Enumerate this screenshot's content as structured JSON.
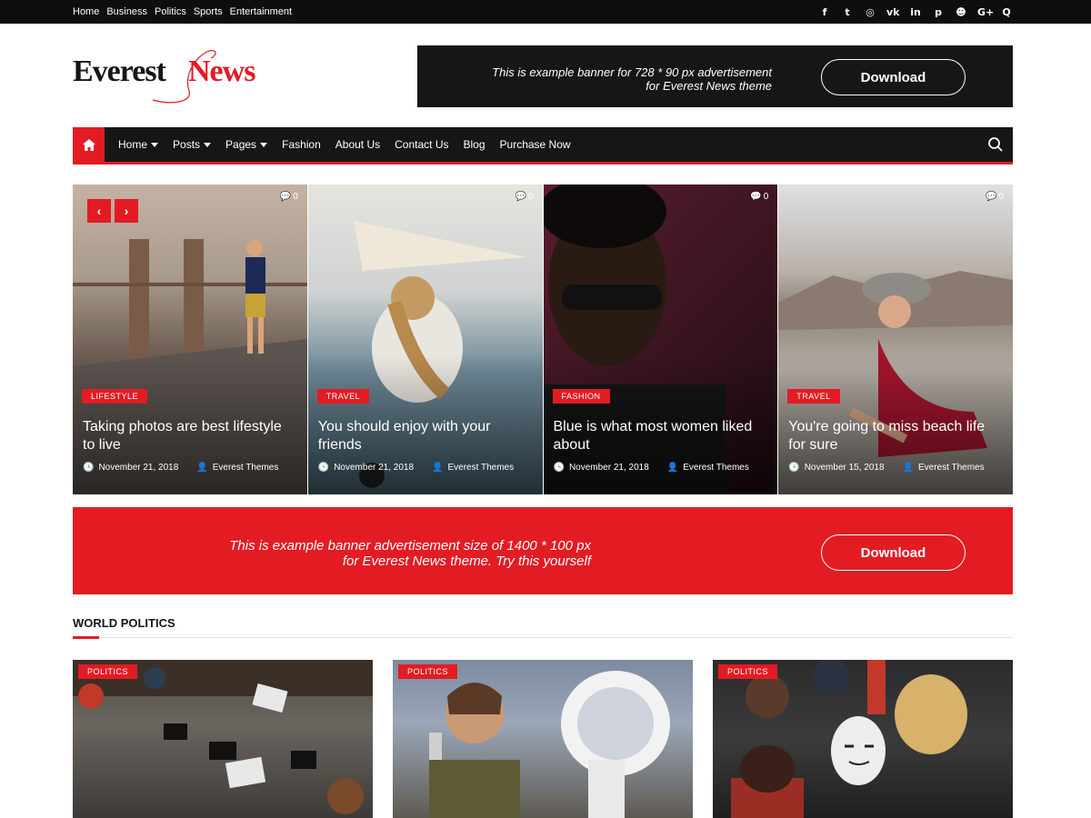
{
  "topbar": {
    "links": [
      "Home",
      "Business",
      "Politics",
      "Sports",
      "Entertainment"
    ],
    "social_icons": [
      "facebook-icon",
      "twitter-icon",
      "instagram-icon",
      "vk-icon",
      "linkedin-icon",
      "pinterest-icon",
      "reddit-icon",
      "google-plus-icon",
      "quora-icon"
    ],
    "social_glyphs": [
      "f",
      "t",
      "◎",
      "vk",
      "in",
      "p",
      "☻",
      "G+",
      "Q"
    ]
  },
  "logo": {
    "word1": "Everest",
    "word2": "News"
  },
  "ad_banner": {
    "line1": "This is example banner for 728 * 90 px advertisement",
    "line2": "for Everest News theme",
    "button": "Download"
  },
  "nav": {
    "items": [
      {
        "label": "Home",
        "dropdown": true
      },
      {
        "label": "Posts",
        "dropdown": true
      },
      {
        "label": "Pages",
        "dropdown": true
      },
      {
        "label": "Fashion",
        "dropdown": false
      },
      {
        "label": "About Us",
        "dropdown": false
      },
      {
        "label": "Contact Us",
        "dropdown": false
      },
      {
        "label": "Blog",
        "dropdown": false
      },
      {
        "label": "Purchase Now",
        "dropdown": false
      }
    ]
  },
  "slider": {
    "prev": "‹",
    "next": "›",
    "slides": [
      {
        "category": "LIFESTYLE",
        "title": "Taking photos are best lifestyle to live",
        "date": "November 21, 2018",
        "author": "Everest Themes",
        "comments": "0"
      },
      {
        "category": "TRAVEL",
        "title": "You should enjoy with your friends",
        "date": "November 21, 2018",
        "author": "Everest Themes",
        "comments": "0"
      },
      {
        "category": "FASHION",
        "title": "Blue is what most women liked about",
        "date": "November 21, 2018",
        "author": "Everest Themes",
        "comments": "0"
      },
      {
        "category": "TRAVEL",
        "title": "You're going to miss beach life for sure",
        "date": "November 15, 2018",
        "author": "Everest Themes",
        "comments": "0"
      }
    ]
  },
  "red_banner": {
    "line1": "This is example banner advertisement size of  1400 * 100 px",
    "line2": "for Everest News theme. Try this yourself",
    "button": "Download"
  },
  "world_politics": {
    "title": "WORLD POLITICS",
    "cards": [
      {
        "category": "POLITICS"
      },
      {
        "category": "POLITICS"
      },
      {
        "category": "POLITICS"
      }
    ]
  },
  "colors": {
    "accent": "#e31b23",
    "dark": "#161616"
  }
}
